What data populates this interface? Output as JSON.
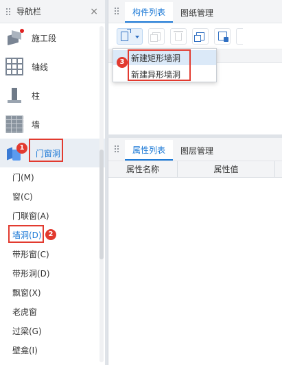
{
  "nav": {
    "title": "导航栏",
    "close_glyph": "×",
    "categories": [
      {
        "label": "施工段",
        "icon": "construction-segment-icon"
      },
      {
        "label": "轴线",
        "icon": "axis-grid-icon"
      },
      {
        "label": "柱",
        "icon": "column-icon"
      },
      {
        "label": "墙",
        "icon": "wall-icon"
      },
      {
        "label": "门窗洞",
        "icon": "door-window-opening-icon"
      }
    ],
    "subitems": [
      "门(M)",
      "窗(C)",
      "门联窗(A)",
      "墙洞(D)",
      "带形窗(C)",
      "带形洞(D)",
      "飘窗(X)",
      "老虎窗",
      "过梁(G)",
      "壁龛(I)"
    ]
  },
  "top_panel": {
    "tabs": [
      "构件列表",
      "图纸管理"
    ]
  },
  "dropdown": {
    "items": [
      "新建矩形墙洞",
      "新建异形墙洞"
    ]
  },
  "bottom_panel": {
    "tabs": [
      "属性列表",
      "图层管理"
    ],
    "columns": [
      "属性名称",
      "属性值"
    ]
  },
  "callouts": [
    "1",
    "2",
    "3"
  ],
  "colors": {
    "accent": "#1a78d6",
    "callout": "#e23a2f",
    "active_bg": "#e9eef4"
  }
}
